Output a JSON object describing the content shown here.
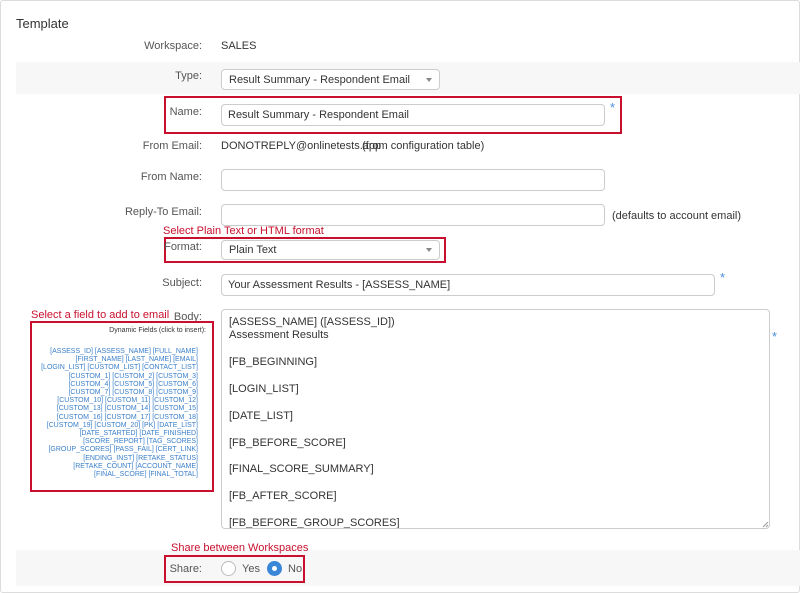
{
  "section_title": "Template",
  "workspace": {
    "label": "Workspace:",
    "value": "SALES"
  },
  "type": {
    "label": "Type:",
    "value": "Result Summary - Respondent Email"
  },
  "name": {
    "label": "Name:",
    "value": "Result Summary - Respondent Email",
    "required": "*"
  },
  "from_email": {
    "label": "From Email:",
    "value": "DONOTREPLY@onlinetests.app",
    "note": "(from configuration table)"
  },
  "from_name": {
    "label": "From Name:",
    "value": ""
  },
  "reply_to": {
    "label": "Reply-To Email:",
    "value": "",
    "note": "(defaults to account email)"
  },
  "format": {
    "label": "Format:",
    "value": "Plain Text",
    "callout": "Select Plain Text or HTML format"
  },
  "subject": {
    "label": "Subject:",
    "value": "Your Assessment Results - [ASSESS_NAME]",
    "required": "*"
  },
  "body": {
    "label": "Body:",
    "required": "*",
    "lines": [
      "[ASSESS_NAME] ([ASSESS_ID])",
      "Assessment Results",
      "",
      "[FB_BEGINNING]",
      "",
      "[LOGIN_LIST]",
      "",
      "[DATE_LIST]",
      "",
      "[FB_BEFORE_SCORE]",
      "",
      "[FINAL_SCORE_SUMMARY]",
      "",
      "[FB_AFTER_SCORE]",
      "",
      "[FB_BEFORE_GROUP_SCORES]"
    ]
  },
  "dynamic_fields": {
    "callout": "Select a field to add to email",
    "title": "Dynamic Fields (click to insert):",
    "lines": [
      "[ASSESS_ID]   [ASSESS_NAME]   [FULL_NAME]",
      "[FIRST_NAME]   [LAST_NAME]   [EMAIL]",
      "[LOGIN_LIST]   [CUSTOM_LIST]   [CONTACT_LIST]",
      "[CUSTOM_1]   [CUSTOM_2]   [CUSTOM_3]",
      "[CUSTOM_4]   [CUSTOM_5]   [CUSTOM_6]",
      "[CUSTOM_7]   [CUSTOM_8]   [CUSTOM_9]",
      "[CUSTOM_10]   [CUSTOM_11]   [CUSTOM_12]",
      "[CUSTOM_13]   [CUSTOM_14]   [CUSTOM_15]",
      "[CUSTOM_16]   [CUSTOM_17]   [CUSTOM_18]",
      "[CUSTOM_19]   [CUSTOM_20]   [PK]   [DATE_LIST]",
      "[DATE_STARTED]   [DATE_FINISHED]",
      "[SCORE_REPORT]   [TAG_SCORES]",
      "[GROUP_SCORES]   [PASS_FAIL]   [CERT_LINK]",
      "[ENDING_INST]   [RETAKE_STATUS]",
      "[RETAKE_COUNT]   [ACCOUNT_NAME]",
      "[FINAL_SCORE]   [FINAL_TOTAL]"
    ]
  },
  "share": {
    "label": "Share:",
    "callout": "Share between Workspaces",
    "yes_label": "Yes",
    "no_label": "No",
    "selected": "No"
  },
  "colors": {
    "accent": "#3a87d8",
    "callout": "#c8102e",
    "link": "#3a7fc9"
  }
}
